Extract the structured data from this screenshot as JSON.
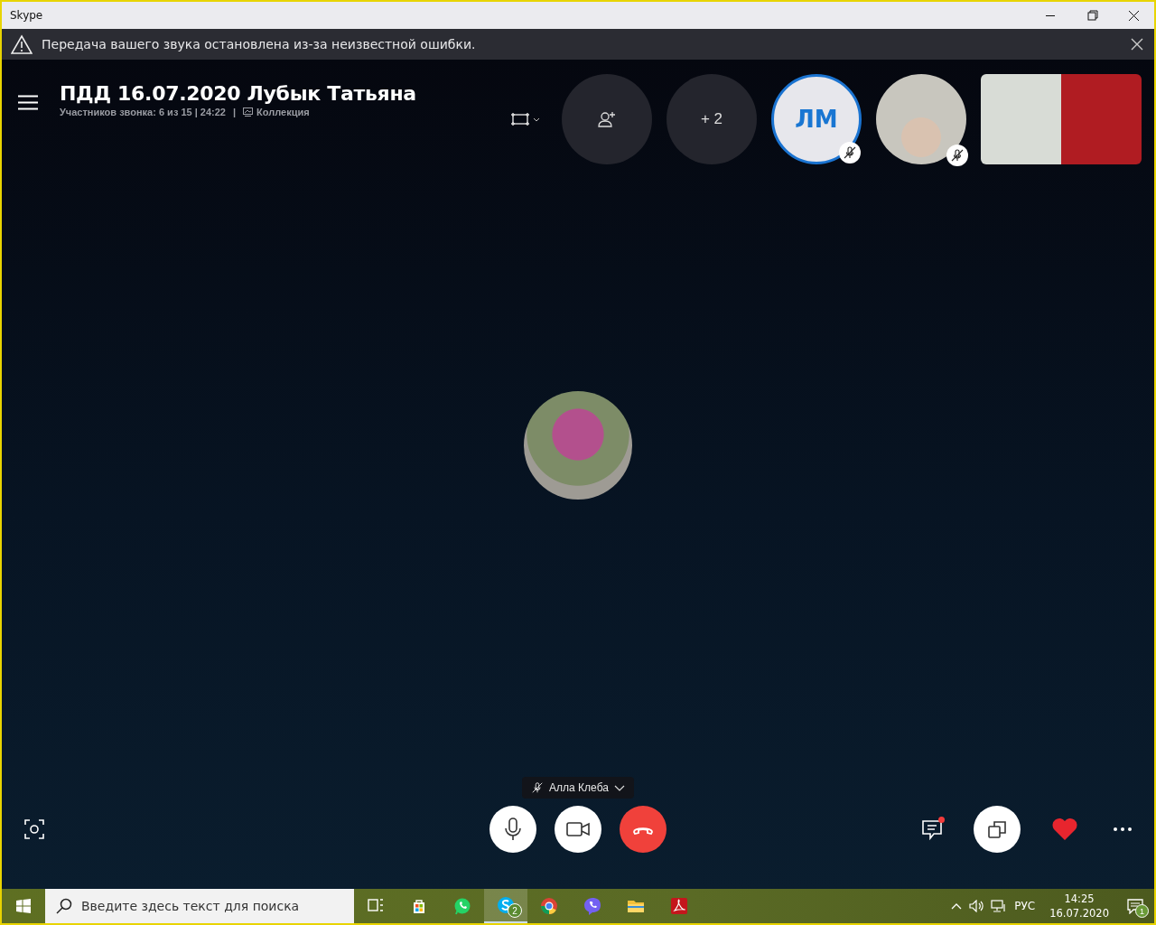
{
  "window": {
    "title": "Skype"
  },
  "banner": {
    "message": "Передача вашего звука остановлена из-за неизвестной ошибки."
  },
  "call": {
    "title": "ПДД 16.07.2020 Лубык Татьяна",
    "info": "Участников звонка: 6 из 15 | 24:22",
    "separator": "|",
    "gallery_link": "Коллекция"
  },
  "participants": [
    {
      "kind": "add"
    },
    {
      "kind": "more",
      "label": "+ 2"
    },
    {
      "kind": "initials",
      "label": "ЛМ",
      "muted": true,
      "highlighted": true
    },
    {
      "kind": "photo",
      "muted": true,
      "highlighted": false
    },
    {
      "kind": "video"
    }
  ],
  "speaker": {
    "name": "Алла Клеба",
    "muted": true
  },
  "chat": {
    "unread": true
  },
  "taskbar": {
    "search_placeholder": "Введите здесь текст для поиска",
    "apps": [
      {
        "kind": "taskview",
        "active": false
      },
      {
        "kind": "store",
        "active": false
      },
      {
        "kind": "whatsapp",
        "active": false
      },
      {
        "kind": "skype",
        "active": true,
        "badge": "2"
      },
      {
        "kind": "chrome",
        "active": false
      },
      {
        "kind": "viber",
        "active": false
      },
      {
        "kind": "explorer",
        "active": false
      },
      {
        "kind": "acrobat",
        "active": false
      }
    ],
    "language": "РУС",
    "time": "14:25",
    "date": "16.07.2020",
    "notifications": "1"
  }
}
